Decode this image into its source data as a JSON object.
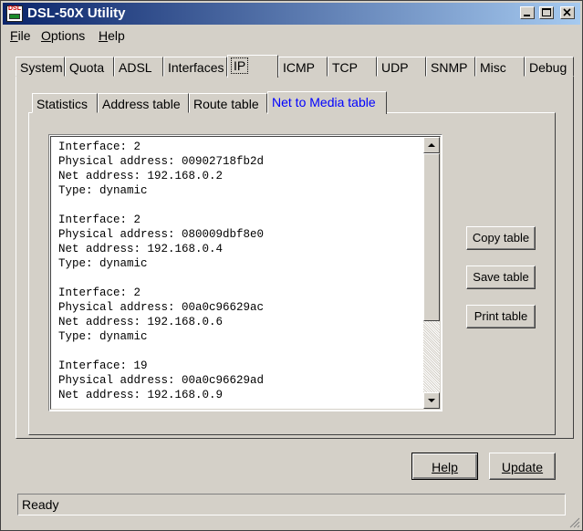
{
  "window": {
    "title": "DSL-50X Utility",
    "icon_label": "DSL"
  },
  "menubar": {
    "items": [
      {
        "label": "File",
        "accel": "F",
        "rest": "ile"
      },
      {
        "label": "Options",
        "accel": "O",
        "rest": "ptions"
      },
      {
        "label": "Help",
        "accel": "H",
        "rest": "elp"
      }
    ]
  },
  "main_tabs": [
    "System",
    "Quota",
    "ADSL",
    "Interfaces",
    "IP",
    "ICMP",
    "TCP",
    "UDP",
    "SNMP",
    "Misc",
    "Debug"
  ],
  "main_tab_selected": "IP",
  "sub_tabs": [
    "Statistics",
    "Address table",
    "Route table",
    "Net to Media table"
  ],
  "sub_tab_selected": "Net to Media table",
  "table_text": {
    "lines": [
      "Interface: 2",
      "Physical address: 00902718fb2d",
      "Net address: 192.168.0.2",
      "Type: dynamic",
      "",
      "Interface: 2",
      "Physical address: 080009dbf8e0",
      "Net address: 192.168.0.4",
      "Type: dynamic",
      "",
      "Interface: 2",
      "Physical address: 00a0c96629ac",
      "Net address: 192.168.0.6",
      "Type: dynamic",
      "",
      "Interface: 19",
      "Physical address: 00a0c96629ad",
      "Net address: 192.168.0.9"
    ]
  },
  "side_buttons": {
    "copy": "Copy table",
    "save": "Save table",
    "print": "Print table"
  },
  "bottom_buttons": {
    "help": "Help",
    "update": "Update"
  },
  "status": {
    "text": "Ready"
  },
  "colors": {
    "title_start": "#0a246a",
    "title_end": "#a6caf0",
    "active_subtab_text": "#0000ff"
  }
}
